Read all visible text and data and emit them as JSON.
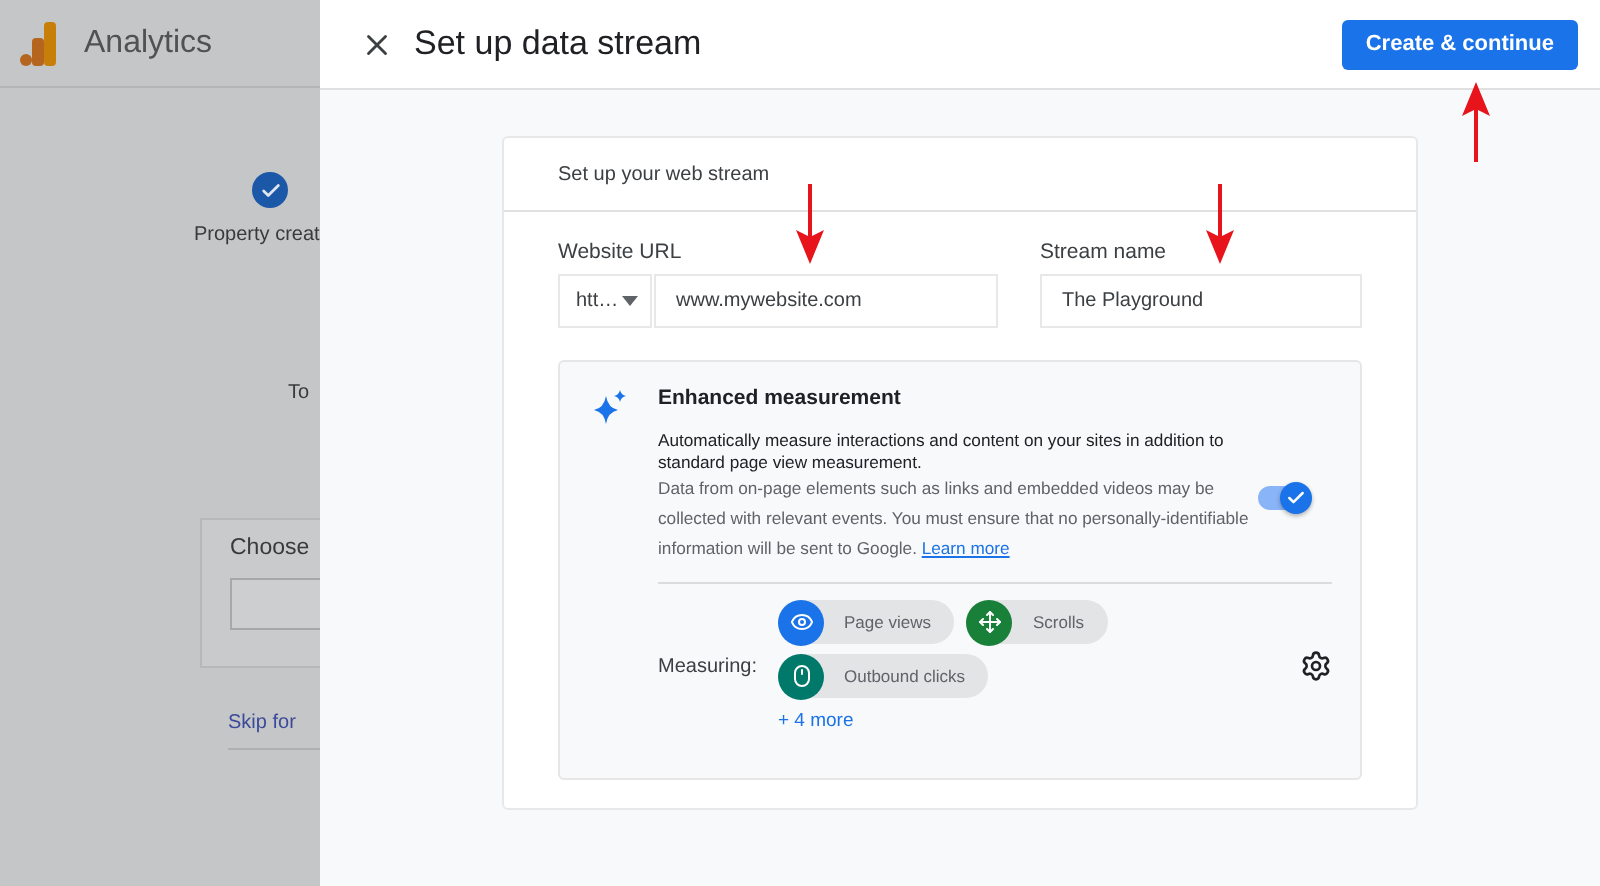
{
  "app": {
    "title": "Analytics"
  },
  "background": {
    "step": {
      "label": "Property creat",
      "done": true
    },
    "lines": [
      "To"
    ],
    "choose_label": "Choose",
    "skip_link": "Skip for"
  },
  "dialog": {
    "title": "Set up data stream",
    "primary_button": "Create & continue"
  },
  "card": {
    "title": "Set up your web stream",
    "url": {
      "label": "Website URL",
      "protocol": "htt…",
      "value": "www.mywebsite.com"
    },
    "stream": {
      "label": "Stream name",
      "value": "The Playground"
    },
    "enhanced": {
      "title": "Enhanced measurement",
      "description": "Automatically measure interactions and content on your sites in addition to standard page view measurement.",
      "note": "Data from on-page elements such as links and embedded videos may be collected with relevant events. You must ensure that no personally-identifiable information will be sent to Google.",
      "link": "Learn more",
      "on": true,
      "measuring_label": "Measuring:",
      "events": [
        {
          "label": "Page views",
          "kind": "views",
          "color": "#1a73e8"
        },
        {
          "label": "Scrolls",
          "kind": "scrolls",
          "color": "#188038"
        },
        {
          "label": "Outbound clicks",
          "kind": "clicks",
          "color": "#00796b"
        }
      ],
      "more": "+ 4 more"
    }
  }
}
